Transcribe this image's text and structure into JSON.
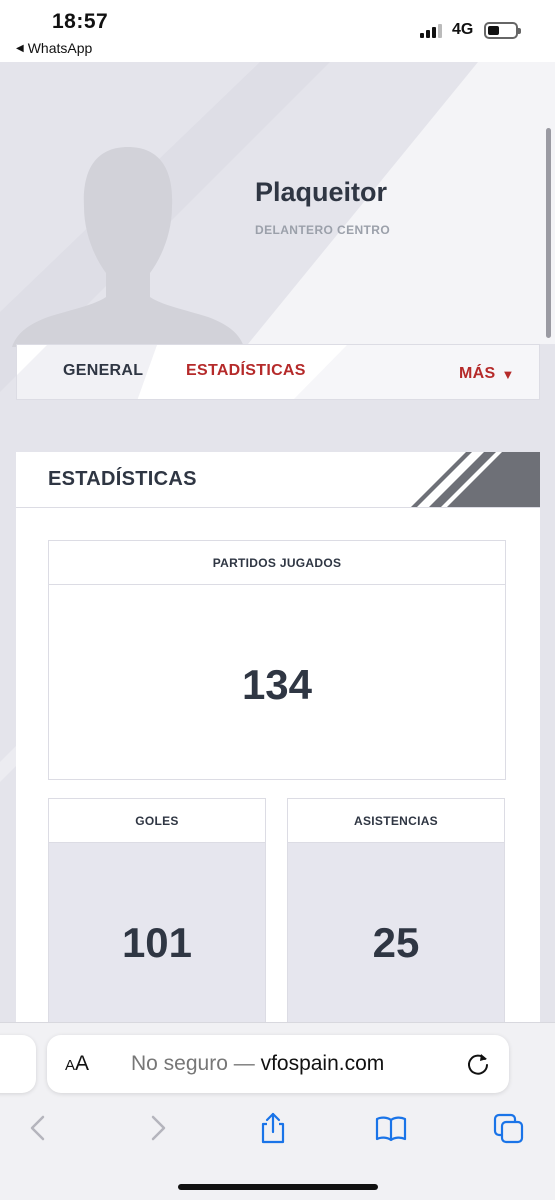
{
  "status_bar": {
    "time": "18:57",
    "back_app": "WhatsApp",
    "network": "4G",
    "back_arrow_icon": "back-triangle-icon"
  },
  "profile": {
    "name": "Plaqueitor",
    "position": "DELANTERO CENTRO",
    "avatar_icon": "person-silhouette-icon"
  },
  "tabs": {
    "general": "GENERAL",
    "stats": "ESTADÍSTICAS",
    "more": "MÁS",
    "more_caret": "▼",
    "active_color": "#b52a2a"
  },
  "stats": {
    "title": "ESTADÍSTICAS",
    "partidos_label": "PARTIDOS JUGADOS",
    "partidos_value": "134",
    "goles_label": "GOLES",
    "goles_value": "101",
    "asistencias_label": "ASISTENCIAS",
    "asistencias_value": "25"
  },
  "safari": {
    "aa_large": "A",
    "aa_small": "A",
    "url_prefix": "No seguro — ",
    "url_domain": "vfospain.com",
    "icons": [
      "back-chevron-icon",
      "forward-chevron-icon",
      "share-icon",
      "bookmarks-icon",
      "tabs-icon",
      "reload-icon"
    ]
  },
  "colors": {
    "accent": "#b52a2a",
    "text_dark": "#2f3643",
    "background": "#e5e5ec"
  }
}
